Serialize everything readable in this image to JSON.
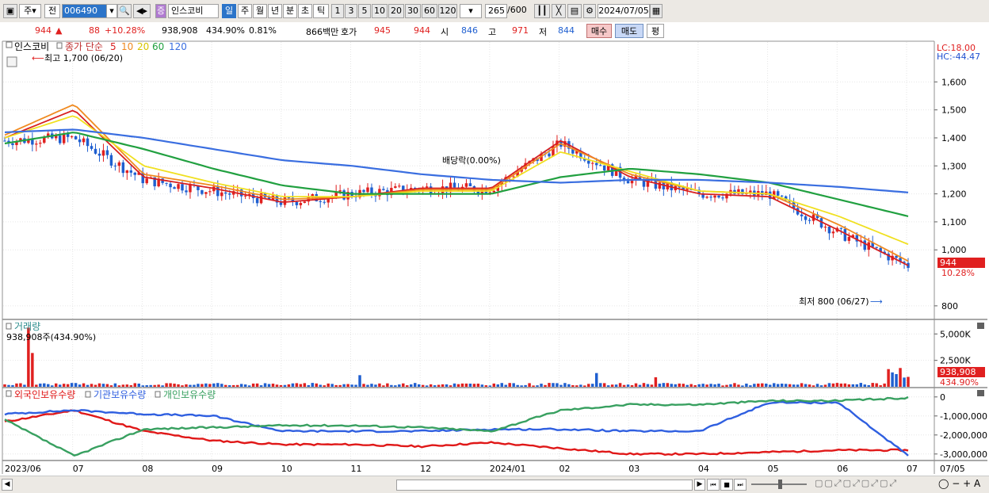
{
  "toolbar": {
    "period_type": "주",
    "prev_label": "전",
    "stock_code": "006490",
    "stock_type_badge": "증",
    "stock_name": "인스코비",
    "period_buttons": [
      "일",
      "주",
      "월",
      "년",
      "분",
      "초",
      "틱"
    ],
    "interval_buttons": [
      "1",
      "3",
      "5",
      "10",
      "20",
      "30",
      "60",
      "120"
    ],
    "count_value": "265",
    "count_total": "/600",
    "date_value": "2024/07/05"
  },
  "info": {
    "price": "944",
    "arrow": "▲",
    "change": "88",
    "change_pct": "+10.28%",
    "volume": "938,908",
    "volume_ratio": "434.90%",
    "turnover": "0.81%",
    "amount": "866백만",
    "quote_label": "호가",
    "ask": "945",
    "bid": "944",
    "open_label": "시",
    "open": "846",
    "high_label": "고",
    "high": "971",
    "low_label": "저",
    "low": "844",
    "buy_label": "매수",
    "sell_label": "매도",
    "avg_label": "평"
  },
  "price_panel": {
    "stock_label": "인스코비",
    "legend_prefix": "종가 단순",
    "ma_periods": [
      "5",
      "10",
      "20",
      "60",
      "120"
    ],
    "lc_label": "LC:18.00",
    "hc_label": "HC:-44.47",
    "high_note": "최고 1,700 (06/20)",
    "low_note": "최저 800 (06/27)",
    "dividend_note": "배당락(0.00%)",
    "current_price_tag": "944",
    "current_pct_tag": "10.28%"
  },
  "volume_panel": {
    "title": "거래량",
    "value_text": "938,908주(434.90%)",
    "current_tag": "938,908",
    "pct_tag": "434.90%"
  },
  "holding_panel": {
    "legend": [
      "외국인보유수량",
      "기관보유수량",
      "개인보유수량"
    ]
  },
  "x_labels": [
    "2023/06",
    "07",
    "08",
    "09",
    "10",
    "11",
    "12",
    "2024/01",
    "02",
    "03",
    "04",
    "05",
    "06",
    "07",
    "07/05"
  ],
  "colors": {
    "up": "#e0201f",
    "down": "#1f5fd0",
    "ma5": "#d82020",
    "ma10": "#f08a20",
    "ma20": "#f0e020",
    "ma60": "#21a040",
    "ma120": "#3a6ee0",
    "foreign": "#e01818",
    "institution": "#2f5fe0",
    "individual": "#38a060"
  },
  "chart_data": [
    {
      "type": "candlestick",
      "title": "인스코비",
      "ylim": [
        760,
        1700
      ],
      "y_ticks": [
        800,
        1000,
        1100,
        1200,
        1300,
        1400,
        1500,
        1600
      ],
      "y_tick_labels": [
        "800",
        "1,000",
        "1,100",
        "1,200",
        "1,300",
        "1,400",
        "1,500",
        "1,600"
      ],
      "x": [
        "2023/06",
        "07",
        "08",
        "09",
        "10",
        "11",
        "12",
        "2024/01",
        "02",
        "03",
        "04",
        "05",
        "06",
        "07"
      ],
      "close": [
        1390,
        1400,
        1250,
        1210,
        1170,
        1200,
        1220,
        1220,
        1380,
        1250,
        1200,
        1200,
        1060,
        944
      ],
      "moving_averages": [
        {
          "name": "5",
          "values": [
            1400,
            1500,
            1260,
            1220,
            1170,
            1190,
            1220,
            1220,
            1390,
            1260,
            1200,
            1190,
            1070,
            944
          ]
        },
        {
          "name": "10",
          "values": [
            1410,
            1520,
            1270,
            1230,
            1180,
            1190,
            1215,
            1215,
            1380,
            1270,
            1210,
            1200,
            1090,
            960
          ]
        },
        {
          "name": "20",
          "values": [
            1400,
            1480,
            1300,
            1240,
            1190,
            1190,
            1210,
            1210,
            1350,
            1280,
            1210,
            1200,
            1120,
            1020
          ]
        },
        {
          "name": "60",
          "values": [
            1380,
            1420,
            1360,
            1290,
            1230,
            1200,
            1200,
            1200,
            1260,
            1290,
            1270,
            1240,
            1180,
            1120
          ]
        },
        {
          "name": "120",
          "values": [
            1420,
            1430,
            1400,
            1360,
            1320,
            1300,
            1270,
            1250,
            1240,
            1250,
            1250,
            1240,
            1225,
            1205
          ]
        }
      ],
      "annotations": [
        "최고 1,700 (06/20)",
        "최저 800 (06/27)",
        "배당락(0.00%)"
      ]
    },
    {
      "type": "bar",
      "title": "거래량",
      "ylim": [
        0,
        6000000
      ],
      "y_ticks": [
        2500000,
        5000000
      ],
      "y_tick_labels": [
        "2,500K",
        "5,000K"
      ],
      "latest": 938908
    },
    {
      "type": "line",
      "title": "보유수량",
      "ylim": [
        -3300000,
        200000
      ],
      "y_ticks": [
        0,
        -1000000,
        -2000000,
        -3000000
      ],
      "y_tick_labels": [
        "0",
        "-1,000,000",
        "-2,000,000",
        "-3,000,000"
      ],
      "x": [
        "2023/06",
        "07",
        "08",
        "09",
        "10",
        "11",
        "12",
        "2024/01",
        "02",
        "03",
        "04",
        "05",
        "06",
        "07"
      ],
      "series": [
        {
          "name": "외국인보유수량",
          "values": [
            -1300000,
            -700000,
            -1800000,
            -2300000,
            -2500000,
            -2500000,
            -2600000,
            -2400000,
            -2700000,
            -3000000,
            -3000000,
            -2900000,
            -2800000,
            -2800000
          ]
        },
        {
          "name": "기관보유수량",
          "values": [
            -900000,
            -700000,
            -900000,
            -1000000,
            -1800000,
            -1800000,
            -1800000,
            -1700000,
            -1700000,
            -1800000,
            -1800000,
            -300000,
            -300000,
            -3100000
          ]
        },
        {
          "name": "개인보유수량",
          "values": [
            -1200000,
            -3100000,
            -1700000,
            -1600000,
            -1500000,
            -1500000,
            -1600000,
            -1800000,
            -700000,
            -400000,
            -400000,
            -200000,
            -200000,
            -50000
          ]
        }
      ]
    }
  ]
}
